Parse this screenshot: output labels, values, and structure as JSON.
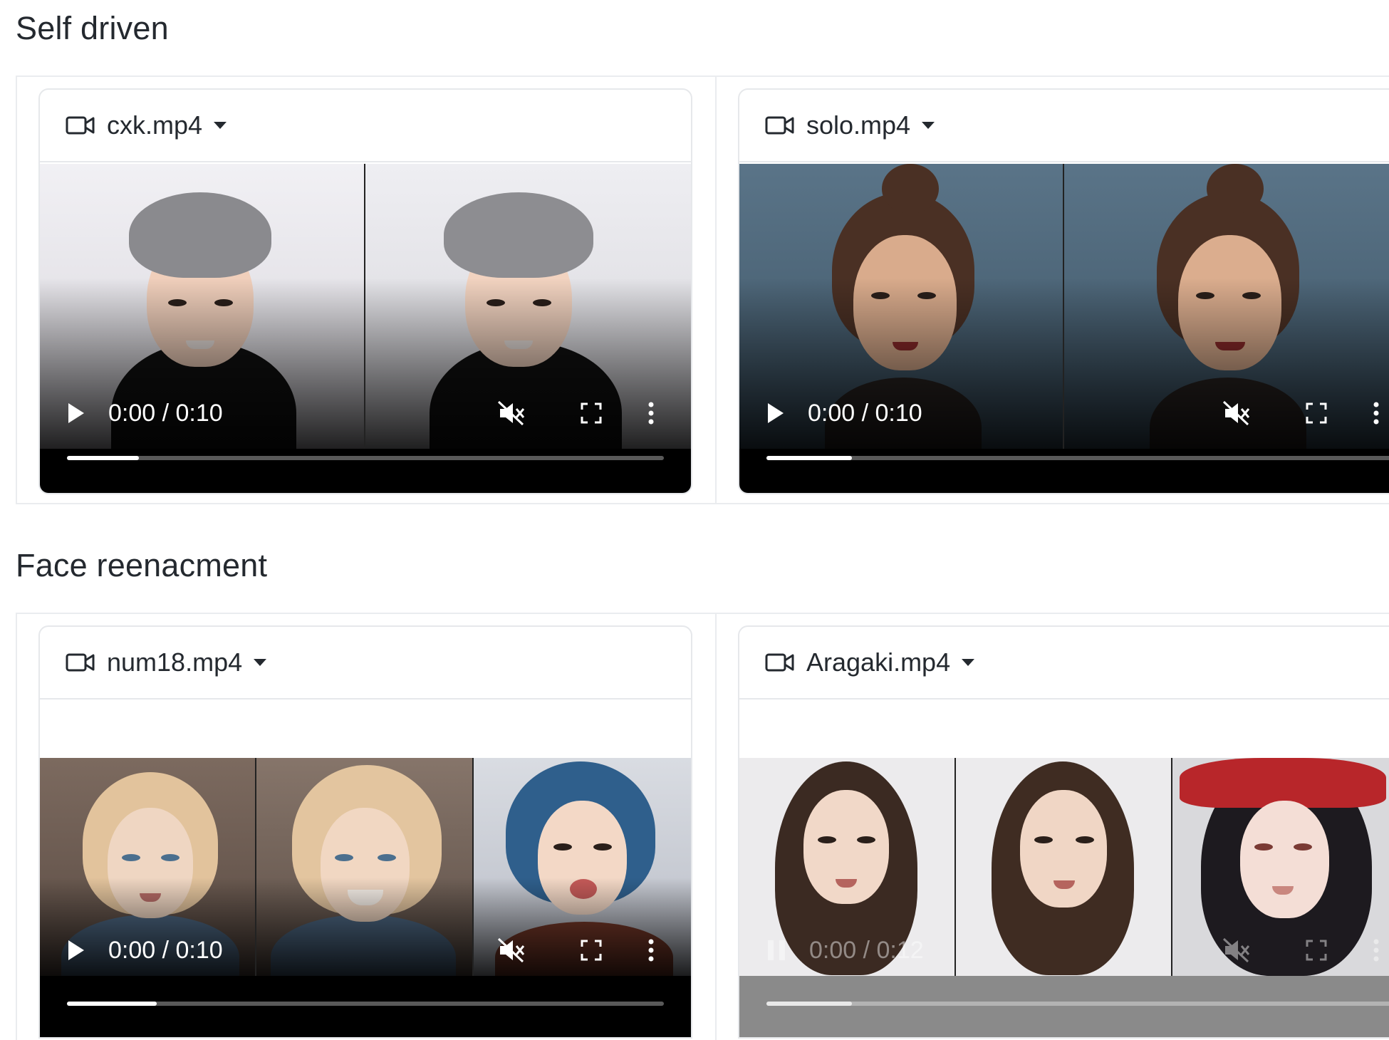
{
  "sections": [
    {
      "title": "Self driven",
      "videos": [
        {
          "filename": "cxk.mp4",
          "time": "0:00 / 0:10",
          "progress": 0.12,
          "state": "paused"
        },
        {
          "filename": "solo.mp4",
          "time": "0:00 / 0:10",
          "progress": 0.13,
          "state": "paused"
        }
      ]
    },
    {
      "title": "Face reenacment",
      "videos": [
        {
          "filename": "num18.mp4",
          "time": "0:00 / 0:10",
          "progress": 0.15,
          "state": "paused"
        },
        {
          "filename": "Aragaki.mp4",
          "time": "0:00 / 0:12",
          "progress": 0.13,
          "state": "playing"
        }
      ]
    }
  ],
  "colors": {
    "border": "#eaecef",
    "text": "#24292f"
  },
  "icons": [
    "video-camera-icon",
    "caret-down-icon",
    "play-icon",
    "pause-icon",
    "mute-icon",
    "fullscreen-icon",
    "more-vert-icon"
  ]
}
